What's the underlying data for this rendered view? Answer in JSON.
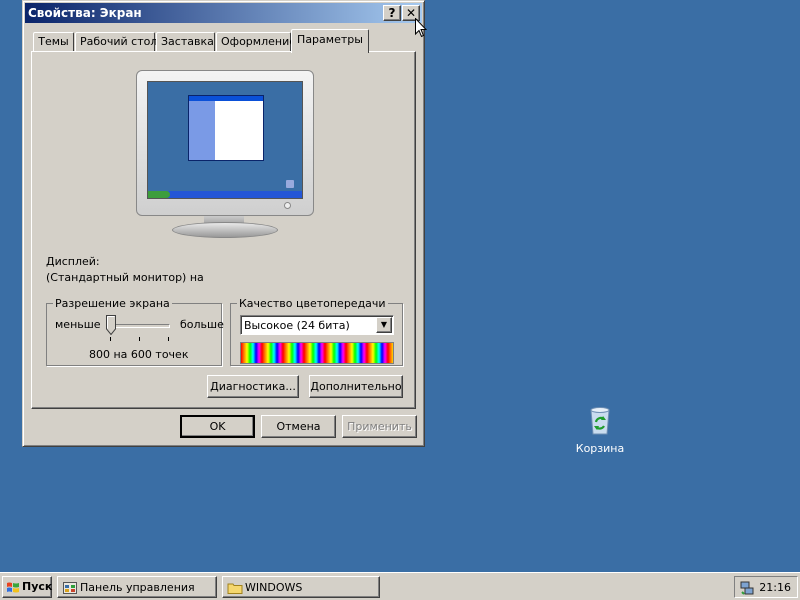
{
  "window": {
    "title": "Свойства: Экран",
    "help_label": "?",
    "close_label": "✕"
  },
  "tabs": [
    {
      "label": "Темы"
    },
    {
      "label": "Рабочий стол"
    },
    {
      "label": "Заставка"
    },
    {
      "label": "Оформление"
    },
    {
      "label": "Параметры",
      "active": true
    }
  ],
  "settings": {
    "display_label": "Дисплей:",
    "display_value": "(Стандартный монитор) на",
    "resolution": {
      "group_title": "Разрешение экрана",
      "less_label": "меньше",
      "more_label": "больше",
      "value_text": "800 на 600 точек"
    },
    "color": {
      "group_title": "Качество цветопередачи",
      "selected": "Высокое (24 бита)"
    },
    "troubleshoot_button": "Диагностика...",
    "advanced_button": "Дополнительно"
  },
  "buttons": {
    "ok": "OK",
    "cancel": "Отмена",
    "apply": "Применить"
  },
  "desktop": {
    "recycle_bin_label": "Корзина"
  },
  "taskbar": {
    "start_label": "Пуск",
    "items": [
      {
        "label": "Панель управления",
        "icon": "control-panel-icon"
      },
      {
        "label": "WINDOWS",
        "icon": "folder-icon"
      }
    ],
    "clock": "21:16"
  },
  "colors": {
    "desktop": "#3a6ea5",
    "face": "#d4d0c8",
    "titlebar_start": "#0a246a",
    "titlebar_end": "#a6caf0"
  }
}
